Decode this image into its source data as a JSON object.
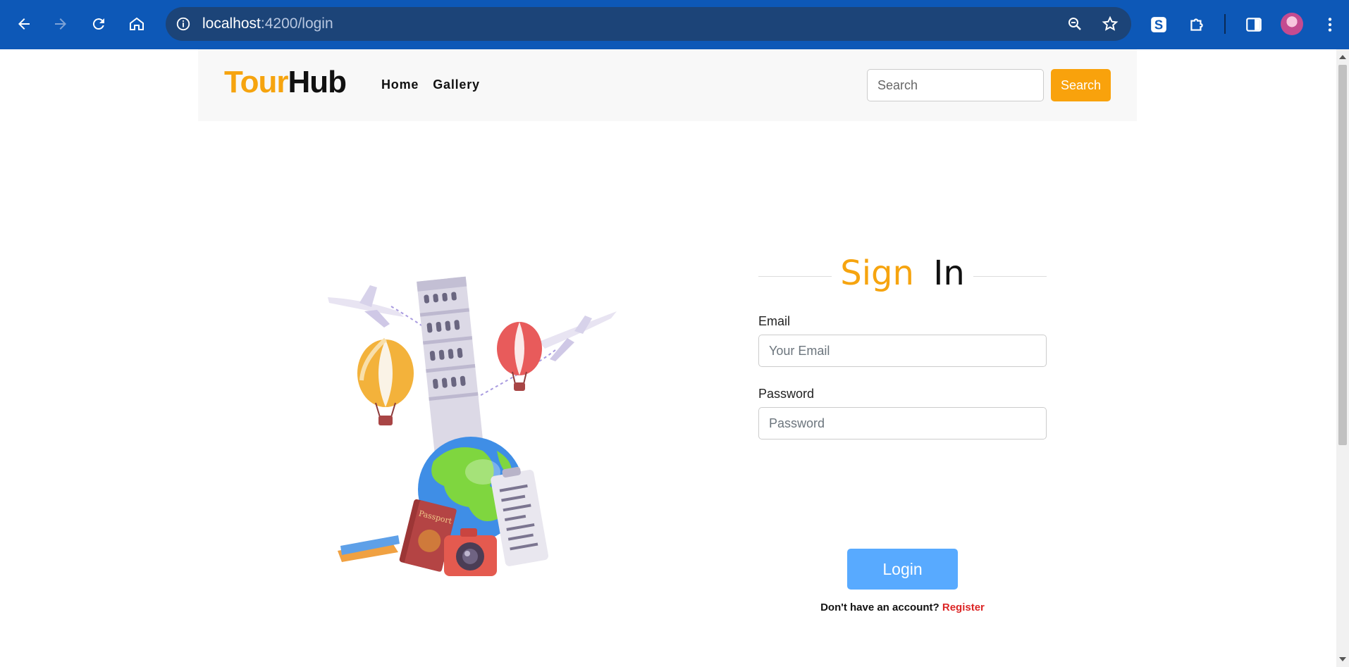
{
  "browser": {
    "url_host": "localhost",
    "url_path": ":4200/login",
    "colors": {
      "chrome": "#0d58b7",
      "omnibox": "#1c4478"
    }
  },
  "site": {
    "brand_part1": "Tour",
    "brand_part2": "Hub",
    "nav": {
      "home": "Home",
      "gallery": "Gallery"
    },
    "search": {
      "placeholder": "Search",
      "button": "Search"
    },
    "colors": {
      "accent": "#f6a40f",
      "login_button": "#58aaff",
      "link": "#dc2626"
    }
  },
  "signin": {
    "title_part1": "Sign",
    "title_part2": "In",
    "email_label": "Email",
    "email_placeholder": "Your Email",
    "password_label": "Password",
    "password_placeholder": "Password",
    "login_button": "Login",
    "no_account_text": "Don't have an account?",
    "register_link": "Register"
  },
  "illustration": {
    "passport_text": "Passport"
  }
}
